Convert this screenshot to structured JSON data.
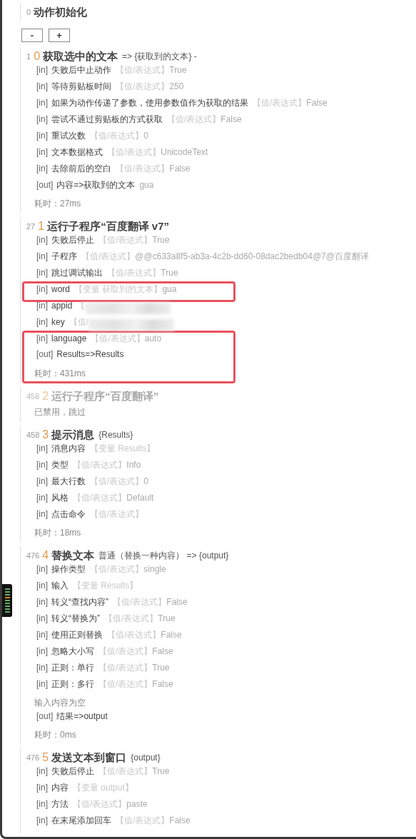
{
  "init": {
    "line": "0",
    "title": "动作初始化"
  },
  "buttons": [
    "-",
    "+"
  ],
  "blocks": [
    {
      "line": "1",
      "index": "0",
      "title": "获取选中的文本",
      "suffix": "=> {获取到的文本} -",
      "disabled": false,
      "items": [
        {
          "kind": "in",
          "tag": "[in]",
          "name": "失败后中止动作",
          "source": "【值/表达式】",
          "value": "True"
        },
        {
          "kind": "in",
          "tag": "[in]",
          "name": "等待剪贴板时间",
          "source": "【值/表达式】",
          "value": "250"
        },
        {
          "kind": "in",
          "tag": "[in]",
          "name": "如果为动作传递了参数，使用参数值作为获取的结果",
          "source": "【值/表达式】",
          "value": "False"
        },
        {
          "kind": "in",
          "tag": "[in]",
          "name": "尝试不通过剪贴板的方式获取",
          "source": "【值/表达式】",
          "value": "False"
        },
        {
          "kind": "in",
          "tag": "[in]",
          "name": "重试次数",
          "source": "【值/表达式】",
          "value": "0"
        },
        {
          "kind": "in",
          "tag": "[in]",
          "name": "文本数据格式",
          "source": "【值/表达式】",
          "value": "UnicodeText"
        },
        {
          "kind": "in",
          "tag": "[in]",
          "name": "去除前后的空白",
          "source": "【值/表达式】",
          "value": "False"
        },
        {
          "kind": "out",
          "tag": "[out]",
          "text": "内容=>获取到的文本",
          "value": "gua"
        },
        {
          "kind": "note",
          "text": "耗时：27ms"
        }
      ]
    },
    {
      "line": "27",
      "index": "1",
      "title": "运行子程序“百度翻译 v7”",
      "disabled": false,
      "items": [
        {
          "kind": "in",
          "tag": "[in]",
          "name": "失败后停止",
          "source": "【值/表达式】",
          "value": "True"
        },
        {
          "kind": "in",
          "tag": "[in]",
          "name": "子程序",
          "source": "【值/表达式】",
          "value": "@@c633a8f5-ab3a-4c2b-dd60-08dac2bedb04@7@百度翻译"
        },
        {
          "kind": "in",
          "tag": "[in]",
          "name": "跳过调试输出",
          "source": "【值/表达式】",
          "value": "True"
        },
        {
          "kind": "highlight",
          "items": [
            {
              "kind": "in",
              "tag": "[in]",
              "name": "word",
              "source": "【变量 获取到的文本】",
              "value": "gua"
            }
          ]
        },
        {
          "kind": "in",
          "tag": "[in]",
          "name": "appid",
          "source": "【",
          "redacted": true
        },
        {
          "kind": "in",
          "tag": "[in]",
          "name": "key",
          "source": "【值/",
          "redacted": true
        },
        {
          "kind": "highlight",
          "items": [
            {
              "kind": "in",
              "tag": "[in]",
              "name": "language",
              "source": "【值/表达式】",
              "value": "auto"
            },
            {
              "kind": "out",
              "tag": "[out]",
              "text": "Results=>Results"
            },
            {
              "kind": "note",
              "text": "耗时：431ms"
            }
          ]
        }
      ]
    },
    {
      "line": "458",
      "index": "2",
      "title": "运行子程序“百度翻译”",
      "disabled": true,
      "items": [
        {
          "kind": "note",
          "text": "已禁用，跳过"
        }
      ]
    },
    {
      "line": "458",
      "index": "3",
      "title": "提示消息",
      "suffix": "{Results}",
      "disabled": false,
      "items": [
        {
          "kind": "in",
          "tag": "[in]",
          "name": "消息内容",
          "source": "【变量 Results】"
        },
        {
          "kind": "in",
          "tag": "[in]",
          "name": "类型",
          "source": "【值/表达式】",
          "value": "Info"
        },
        {
          "kind": "in",
          "tag": "[in]",
          "name": "最大行数",
          "source": "【值/表达式】",
          "value": "0"
        },
        {
          "kind": "in",
          "tag": "[in]",
          "name": "风格",
          "source": "【值/表达式】",
          "value": "Default"
        },
        {
          "kind": "in",
          "tag": "[in]",
          "name": "点击命令",
          "source": "【值/表达式】"
        },
        {
          "kind": "note",
          "text": "耗时：18ms"
        }
      ]
    },
    {
      "line": "476",
      "index": "4",
      "title": "替换文本",
      "suffix": "普通（替换一种内容） => {output}",
      "disabled": false,
      "items": [
        {
          "kind": "in",
          "tag": "[in]",
          "name": "操作类型",
          "source": "【值/表达式】",
          "value": "single"
        },
        {
          "kind": "in",
          "tag": "[in]",
          "name": "输入",
          "source": "【变量 Results】"
        },
        {
          "kind": "in",
          "tag": "[in]",
          "name": "转义“查找内容”",
          "source": "【值/表达式】",
          "value": "False"
        },
        {
          "kind": "in",
          "tag": "[in]",
          "name": "转义“替换为”",
          "source": "【值/表达式】",
          "value": "True"
        },
        {
          "kind": "in",
          "tag": "[in]",
          "name": "使用正则替换",
          "source": "【值/表达式】",
          "value": "False"
        },
        {
          "kind": "in",
          "tag": "[in]",
          "name": "忽略大小写",
          "source": "【值/表达式】",
          "value": "False"
        },
        {
          "kind": "in",
          "tag": "[in]",
          "name": "正则：单行",
          "source": "【值/表达式】",
          "value": "True"
        },
        {
          "kind": "in",
          "tag": "[in]",
          "name": "正则：多行",
          "source": "【值/表达式】",
          "value": "False"
        },
        {
          "kind": "note",
          "text": "输入内容为空"
        },
        {
          "kind": "out",
          "tag": "[out]",
          "text": "结果=>output"
        },
        {
          "kind": "note",
          "text": "耗时：0ms"
        }
      ]
    },
    {
      "line": "476",
      "index": "5",
      "title": "发送文本到窗口",
      "suffix": "{output}",
      "disabled": false,
      "items": [
        {
          "kind": "in",
          "tag": "[in]",
          "name": "失败后停止",
          "source": "【值/表达式】",
          "value": "True"
        },
        {
          "kind": "in",
          "tag": "[in]",
          "name": "内容",
          "source": "【变量 output】"
        },
        {
          "kind": "in",
          "tag": "[in]",
          "name": "方法",
          "source": "【值/表达式】",
          "value": "paste"
        },
        {
          "kind": "in",
          "tag": "[in]",
          "name": "在末尾添加回车",
          "source": "【值/表达式】",
          "value": "False"
        }
      ]
    }
  ]
}
